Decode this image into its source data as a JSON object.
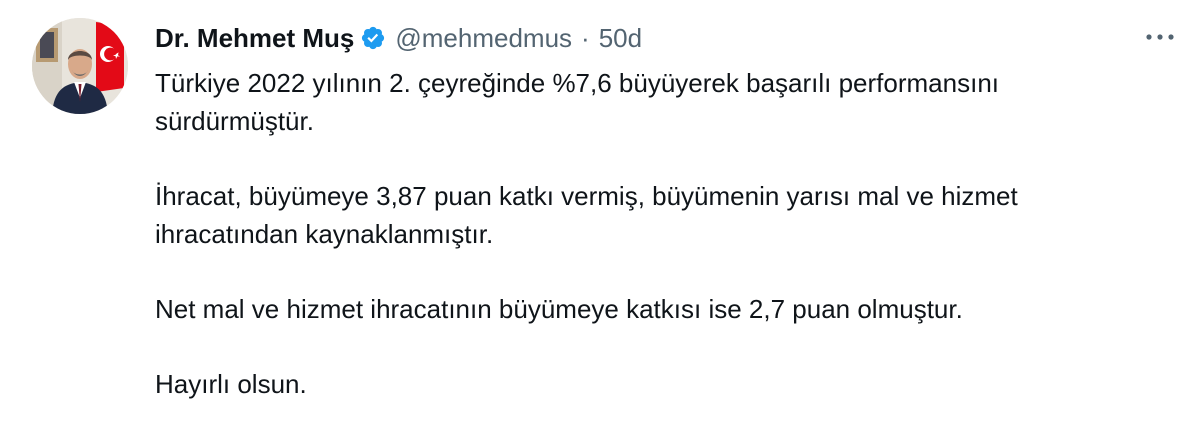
{
  "author": {
    "name": "Dr. Mehmet Muş",
    "handle": "@mehmedmus",
    "separator": "·",
    "time": "50d",
    "verified": true,
    "avatar_icon": "profile-photo-with-flag"
  },
  "tweet": {
    "paragraphs": [
      "Türkiye 2022 yılının 2. çeyreğinde %7,6 büyüyerek başarılı performansını sürdürmüştür.",
      "İhracat, büyümeye 3,87 puan katkı vermiş, büyümenin yarısı mal ve hizmet ihracatından kaynaklanmıştır.",
      "Net mal ve hizmet ihracatının büyümeye katkısı ise 2,7 puan olmuştur.",
      "Hayırlı olsun."
    ]
  },
  "colors": {
    "text": "#0f1419",
    "secondary": "#536471",
    "verified_blue": "#1d9bf0",
    "flag_red": "#e30a17"
  },
  "icons": {
    "verified": "verified-badge-icon",
    "more": "more-options-icon"
  }
}
